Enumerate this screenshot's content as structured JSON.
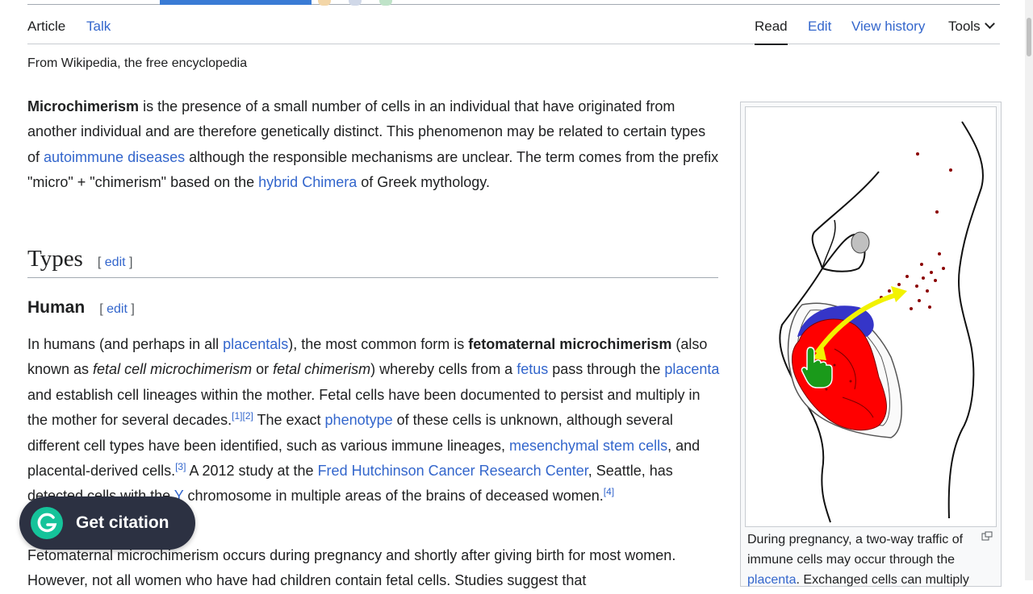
{
  "tabs": {
    "article": "Article",
    "talk": "Talk",
    "read": "Read",
    "edit": "Edit",
    "history": "View history",
    "tools": "Tools"
  },
  "tagline": "From Wikipedia, the free encyclopedia",
  "intro": {
    "bold": "Microchimerism",
    "t1": " is the presence of a small number of cells in an individual that have originated from another individual and are therefore genetically distinct. This phenomenon may be related to certain types of ",
    "link1": "autoimmune diseases",
    "t2": " although the responsible mechanisms are unclear. The term comes from the prefix \"micro\" + \"chimerism\" based on the ",
    "link2": "hybrid Chimera",
    "t3": " of Greek mythology."
  },
  "section_types": {
    "title": "Types",
    "edit_open": "[",
    "edit": "edit",
    "edit_close": "]"
  },
  "section_human": {
    "title": "Human",
    "edit_open": "[",
    "edit": "edit",
    "edit_close": "]"
  },
  "human_para": {
    "t1": "In humans (and perhaps in all ",
    "l_placentals": "placentals",
    "t2": "), the most common form is ",
    "b1": "fetomaternal microchimerism",
    "t3": " (also known as ",
    "i1": "fetal cell microchimerism",
    "t4": " or ",
    "i2": "fetal chimerism",
    "t5": ") whereby cells from a ",
    "l_fetus": "fetus",
    "t6": " pass through the ",
    "l_placenta": "placenta",
    "t7": " and establish cell lineages within the mother. Fetal cells have been documented to persist and multiply in the mother for several decades.",
    "ref1": "[1]",
    "ref2": "[2]",
    "t8": " The exact ",
    "l_phenotype": "phenotype",
    "t9": " of these cells is unknown, although several different cell types have been identified, such as various immune lineages, ",
    "l_msc": "mesenchymal stem cells",
    "t10": ", and placental-derived cells.",
    "ref3": "[3]",
    "t11": " A 2012 study at the ",
    "l_fred": "Fred Hutchinson Cancer Research Center",
    "t12": ", Seattle, has detected cells with the ",
    "l_y": "Y",
    "t13": " chromosome in multiple areas of the brains of deceased women.",
    "ref4": "[4]"
  },
  "next_para": {
    "t1": "Fetomaternal microchimerism occurs during pregnancy and shortly after giving birth for most women. However, not all women who have had children contain fetal cells. Studies suggest that"
  },
  "figure": {
    "caption_t1": "During pregnancy, a two-way traffic of immune cells may occur through the ",
    "caption_link": "placenta",
    "caption_t2": ". Exchanged cells can multiply"
  },
  "citation_button": {
    "label": "Get citation",
    "icon": "grammarly-g-icon",
    "color": "#2c3142",
    "accent": "#15c39a"
  },
  "colors": {
    "link": "#3366cc",
    "text": "#202122",
    "womb_red": "#ff0000",
    "placenta_blue": "#3535c8",
    "arrow_yellow": "#f2f200",
    "cursor_green": "#1a9a1a"
  }
}
